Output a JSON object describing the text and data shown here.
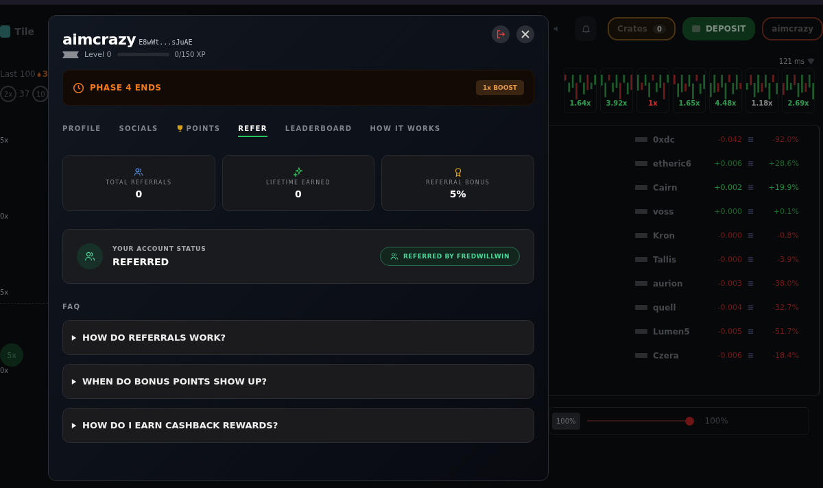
{
  "background": {
    "game_tab": {
      "label": "Tile"
    },
    "topbar": {
      "crates": {
        "label": "Crates",
        "count": "0"
      },
      "deposit": "DEPOSIT",
      "user": "aimcrazy"
    },
    "recent": {
      "label": "Last 100",
      "streak": "3",
      "chips": [
        {
          "label": "2x",
          "kind": "circle"
        },
        {
          "label": "37",
          "kind": "plain"
        },
        {
          "label": "10",
          "kind": "circle"
        }
      ]
    },
    "axis_labels": [
      "5x",
      "0x",
      "5x"
    ],
    "marker": {
      "label": "5x",
      "axis": "0x"
    },
    "ping": "121 ms",
    "rounds": [
      {
        "label": "1.64x",
        "color": "#2e9a50"
      },
      {
        "label": "3.92x",
        "color": "#2e9a50"
      },
      {
        "label": "1x",
        "color": "#d03030"
      },
      {
        "label": "1.65x",
        "color": "#2e9a50"
      },
      {
        "label": "4.48x",
        "color": "#2e9a50"
      },
      {
        "label": "1.18x",
        "color": "#8a8a8a"
      },
      {
        "label": "2.69x",
        "color": "#2e9a50"
      }
    ],
    "players": [
      {
        "name": "0xdc",
        "pnl": "-0.042",
        "pct": "-92.0%",
        "color": "#7a1a1a"
      },
      {
        "name": "etheric6",
        "pnl": "+0.006",
        "pct": "+28.6%",
        "color": "#1a6a2e"
      },
      {
        "name": "Cairn",
        "pnl": "+0.002",
        "pct": "+19.9%",
        "color": "#1f8f3a"
      },
      {
        "name": "voss",
        "pnl": "+0.000",
        "pct": "+0.1%",
        "color": "#1a6a2e"
      },
      {
        "name": "Kron",
        "pnl": "-0.000",
        "pct": "-0.8%",
        "color": "#7a1a1a"
      },
      {
        "name": "Tallis",
        "pnl": "-0.000",
        "pct": "-3.9%",
        "color": "#7a1a1a"
      },
      {
        "name": "aurion",
        "pnl": "-0.003",
        "pct": "-38.0%",
        "color": "#7a1a1a"
      },
      {
        "name": "quell",
        "pnl": "-0.004",
        "pct": "-32.7%",
        "color": "#7a1a1a"
      },
      {
        "name": "Lumen5",
        "pnl": "-0.005",
        "pct": "-51.7%",
        "color": "#7a1a1a"
      },
      {
        "name": "Czera",
        "pnl": "-0.006",
        "pct": "-18.4%",
        "color": "#7a1a1a"
      }
    ],
    "bet": {
      "chip": "100%",
      "level": 1,
      "reading": "100%"
    }
  },
  "modal": {
    "username": "aimcrazy",
    "wallet": "E8wWt...sJuAE",
    "level": {
      "label": "Level 0",
      "level": 0,
      "xp": "0/150 XP"
    },
    "phase": {
      "title": "PHASE 4 ENDS",
      "boost": "1x BOOST"
    },
    "tabs": [
      {
        "label": "PROFILE",
        "selected": false
      },
      {
        "label": "SOCIALS",
        "selected": false
      },
      {
        "label": "POINTS",
        "selected": false
      },
      {
        "label": "REFER",
        "selected": true
      },
      {
        "label": "LEADERBOARD",
        "selected": false
      },
      {
        "label": "HOW IT WORKS",
        "selected": false
      }
    ],
    "stats": [
      {
        "label": "TOTAL REFERRALS",
        "value": "0"
      },
      {
        "label": "LIFETIME EARNED",
        "value": "0"
      },
      {
        "label": "REFERRAL BONUS",
        "value": "5%"
      }
    ],
    "status": {
      "label": "YOUR ACCOUNT STATUS",
      "value": "REFERRED",
      "referrer": "REFERRED BY FREDWILLWIN"
    },
    "faq": {
      "title": "FAQ",
      "items": [
        {
          "question": "HOW DO REFERRALS WORK?",
          "expanded": false
        },
        {
          "question": "WHEN DO BONUS POINTS SHOW UP?",
          "expanded": false
        },
        {
          "question": "HOW DO I EARN CASHBACK REWARDS?",
          "expanded": false
        }
      ]
    }
  }
}
